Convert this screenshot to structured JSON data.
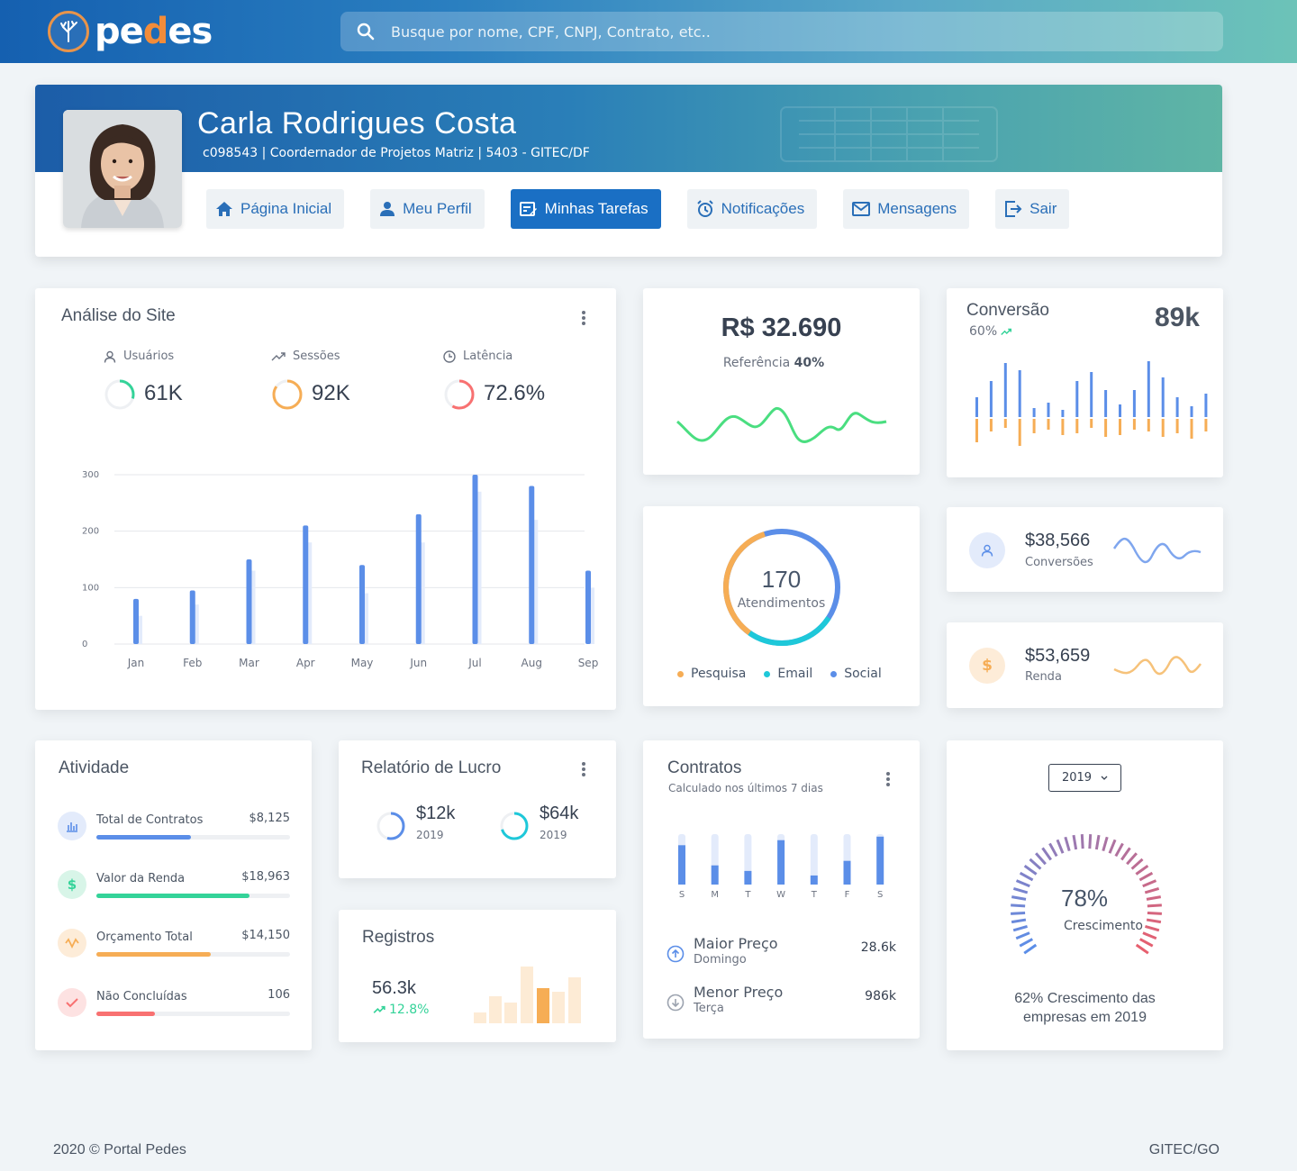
{
  "brand": {
    "logo_text_a": "pe",
    "logo_text_b": "d",
    "logo_text_c": "es"
  },
  "search": {
    "placeholder": "Busque por nome, CPF, CNPJ, Contrato, etc.."
  },
  "profile": {
    "name": "Carla Rodrigues Costa",
    "subtitle": "c098543 | Coordernador de Projetos Matriz | 5403 - GITEC/DF"
  },
  "nav": {
    "home": "Página Inicial",
    "profile": "Meu Perfil",
    "tasks": "Minhas Tarefas",
    "notifications": "Notificações",
    "messages": "Mensagens",
    "logout": "Sair"
  },
  "site_analysis": {
    "title": "Análise do Site",
    "users_label": "Usuários",
    "users_value": "61K",
    "sessions_label": "Sessões",
    "sessions_value": "92K",
    "latency_label": "Latência",
    "latency_value": "72.6%"
  },
  "chart_data": [
    {
      "type": "bar",
      "categories": [
        "Jan",
        "Feb",
        "Mar",
        "Apr",
        "May",
        "Jun",
        "Jul",
        "Aug",
        "Sep"
      ],
      "series": [
        {
          "values": [
            80,
            95,
            150,
            210,
            140,
            230,
            300,
            280,
            130
          ]
        },
        {
          "values": [
            50,
            70,
            130,
            180,
            90,
            180,
            270,
            220,
            100
          ]
        }
      ],
      "ylim": [
        0,
        300
      ],
      "yticks": [
        0,
        100,
        200,
        300
      ]
    },
    {
      "type": "bar",
      "categories": [
        "S",
        "M",
        "T",
        "W",
        "T",
        "F",
        "S"
      ],
      "values": [
        0.78,
        0.38,
        0.27,
        0.88,
        0.18,
        0.47,
        0.95
      ]
    }
  ],
  "revenue": {
    "amount": "R$ 32.690",
    "ref_label": "Referência",
    "ref_value": "40%"
  },
  "conversion": {
    "title": "Conversão",
    "percent": "60%",
    "value": "89k"
  },
  "attendance": {
    "value": "170",
    "label": "Atendimentos",
    "legend": [
      "Pesquisa",
      "Email",
      "Social"
    ]
  },
  "conversions_card": {
    "value": "$38,566",
    "label": "Conversões"
  },
  "income_card": {
    "value": "$53,659",
    "label": "Renda"
  },
  "activity": {
    "title": "Atividade",
    "rows": [
      {
        "label": "Total de Contratos",
        "value": "$8,125",
        "pct": 0.49
      },
      {
        "label": "Valor da Renda",
        "value": "$18,963",
        "pct": 0.79
      },
      {
        "label": "Orçamento Total",
        "value": "$14,150",
        "pct": 0.59
      },
      {
        "label": "Não Concluídas",
        "value": "106",
        "pct": 0.3
      }
    ]
  },
  "profit": {
    "title": "Relatório de Lucro",
    "a_value": "$12k",
    "a_year": "2019",
    "b_value": "$64k",
    "b_year": "2019"
  },
  "records": {
    "title": "Registros",
    "value": "56.3k",
    "growth": "12.8%"
  },
  "contracts": {
    "title": "Contratos",
    "subtitle": "Calculado nos últimos 7 dias",
    "max_label": "Maior Preço",
    "max_day": "Domingo",
    "max_value": "28.6k",
    "min_label": "Menor Preço",
    "min_day": "Terça",
    "min_value": "986k"
  },
  "growth": {
    "year": "2019",
    "percent": "78%",
    "label": "Crescimento",
    "caption_a": "62% Crescimento das",
    "caption_b": "empresas em 2019"
  },
  "footer": {
    "left": "2020 © Portal Pedes",
    "right": "GITEC/GO"
  },
  "colors": {
    "primary": "#1a6fc4",
    "blue": "#5b8ee8",
    "orange": "#f6ad55",
    "green": "#34d399",
    "cyan": "#1ec8d9",
    "red": "#f87171"
  }
}
